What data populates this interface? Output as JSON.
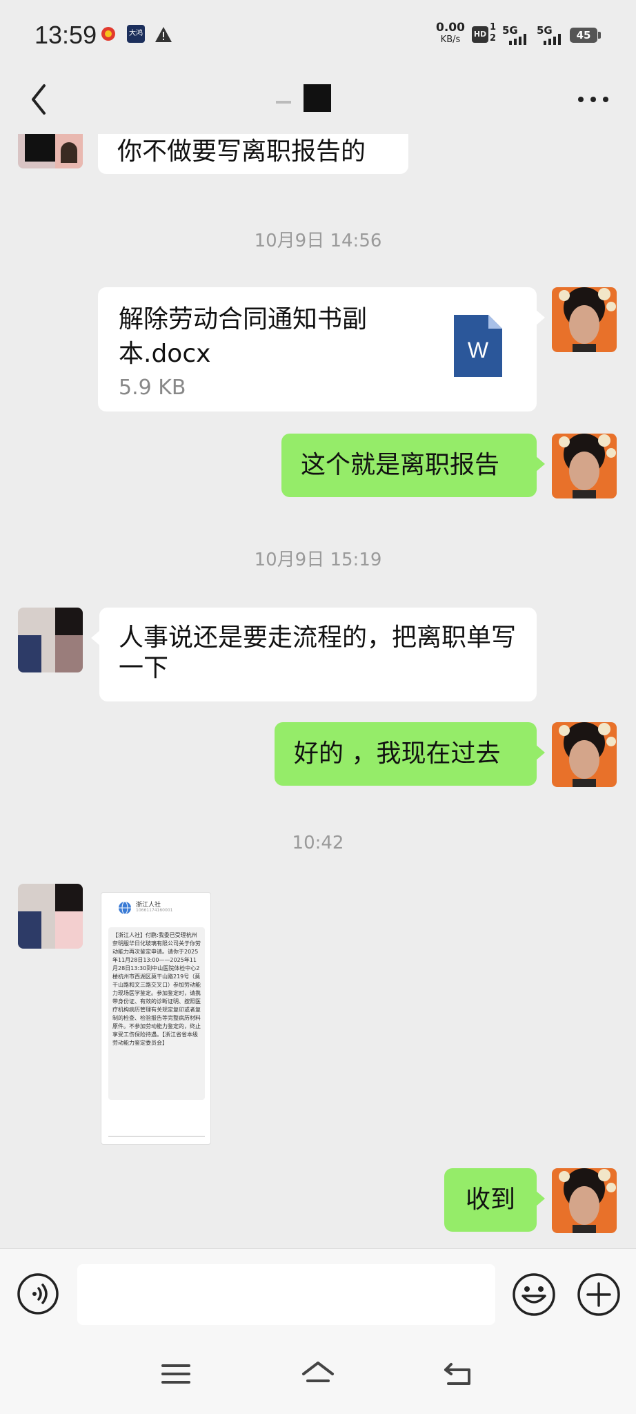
{
  "status_bar": {
    "time": "13:59",
    "app_badge": "大鸿",
    "speed_value": "0.00",
    "speed_unit": "KB/s",
    "hd_label": "HD",
    "sim1_label": "1",
    "sim2_label": "2",
    "network1": "5G",
    "network2": "5G",
    "battery": "45"
  },
  "header": {
    "back_icon": "chevron-left-icon",
    "more_icon": "more-dots-icon"
  },
  "messages": [
    {
      "side": "in",
      "text": "你不做要写离职报告的"
    },
    {
      "timestamp": "10月9日 14:56"
    },
    {
      "side": "out",
      "type": "file",
      "file_name": "解除劳动合同通知书副本.docx",
      "file_size": "5.9 KB",
      "icon": "word-file-icon"
    },
    {
      "side": "out",
      "text": "这个就是离职报告"
    },
    {
      "timestamp": "10月9日 15:19"
    },
    {
      "side": "in",
      "text": "人事说还是要走流程的，把离职单写一下"
    },
    {
      "side": "out",
      "text": "好的 ，我现在过去"
    },
    {
      "timestamp": "10:42"
    },
    {
      "side": "in",
      "type": "image",
      "thumb_title": "浙江人社",
      "thumb_subtitle": "10661174160001",
      "thumb_body": "【浙江人社】付鹏:我委已受理杭州奈明服华日化玻璃有限公司关于你劳动能力再次鉴定申请。请你于2025年11月28日13:00——2025年11月28日13:30到中山医院体检中心2楼杭州市西湖区莫干山路219号（莫干山路和文三路交叉口）参加劳动能力现场医学鉴定。参加鉴定时，请携带身份证、有效的诊断证明、按照医疗机构病历管理有关规定复印或者复制的检查、检验报告等完整病历材料原件。不参加劳动能力鉴定的，终止享受工伤保险待遇。【浙江省省本级劳动能力鉴定委员会】"
    },
    {
      "side": "out",
      "text": "收到"
    }
  ],
  "input_bar": {
    "placeholder": "",
    "voice_icon": "voice-icon",
    "emoji_icon": "emoji-icon",
    "plus_icon": "plus-icon"
  },
  "nav_bar": {
    "menu_icon": "menu-icon",
    "home_icon": "home-icon",
    "back_icon": "back-icon"
  }
}
